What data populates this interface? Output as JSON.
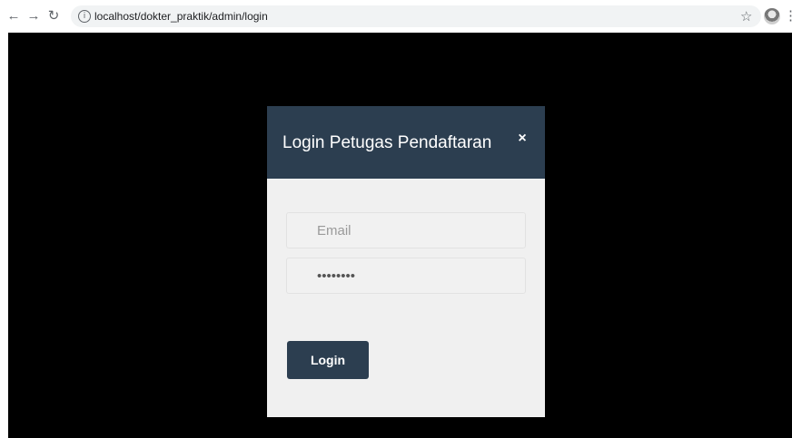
{
  "browser": {
    "back_icon": "arrow-left",
    "forward_icon": "arrow-right",
    "reload_icon": "reload",
    "url": "localhost/dokter_praktik/admin/login",
    "bookmark_icon": "star-outline",
    "menu_icon": "vertical-ellipsis"
  },
  "modal": {
    "title": "Login Petugas Pendaftaran",
    "close_label": "×",
    "email_placeholder": "Email",
    "password_value": "********",
    "login_label": "Login"
  },
  "colors": {
    "page_background": "#000000",
    "modal_header": "#2c3e50",
    "modal_body": "#f0f0f0",
    "button": "#2c3e50"
  }
}
